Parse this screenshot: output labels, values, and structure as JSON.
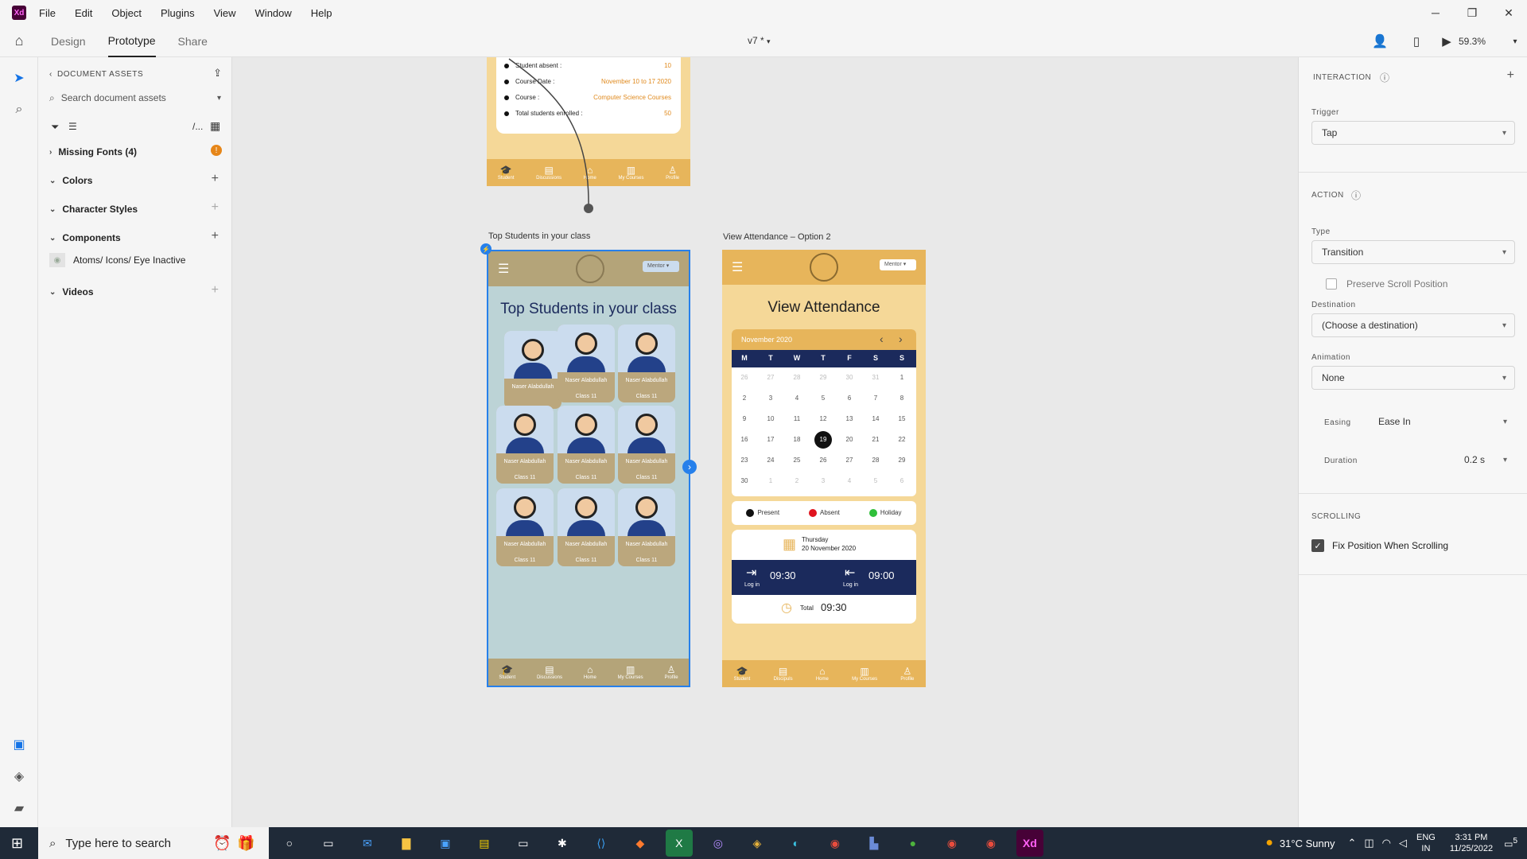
{
  "app": {
    "logo": "Xd",
    "menu": [
      "File",
      "Edit",
      "Object",
      "Plugins",
      "View",
      "Window",
      "Help"
    ],
    "modes": [
      "Design",
      "Prototype",
      "Share"
    ],
    "active_mode": "Prototype",
    "doc_title": "v7 *",
    "zoom": "59.3%"
  },
  "assets": {
    "header": "DOCUMENT ASSETS",
    "search_placeholder": "Search document assets",
    "view_toggle": "/...",
    "sections": {
      "missing_fonts": "Missing Fonts (4)",
      "colors": "Colors",
      "character_styles": "Character Styles",
      "components": "Components",
      "component_item": "Atoms/ Icons/ Eye Inactive",
      "videos": "Videos"
    }
  },
  "interaction": {
    "header": "INTERACTION",
    "trigger_label": "Trigger",
    "trigger_value": "Tap",
    "action_header": "ACTION",
    "type_label": "Type",
    "type_value": "Transition",
    "preserve_scroll": "Preserve Scroll Position",
    "destination_label": "Destination",
    "destination_value": "(Choose a destination)",
    "animation_label": "Animation",
    "animation_value": "None",
    "easing_label": "Easing",
    "easing_value": "Ease In",
    "duration_label": "Duration",
    "duration_value": "0.2 s",
    "scrolling_header": "SCROLLING",
    "fix_position": "Fix Position When Scrolling"
  },
  "top_artboard": {
    "rows": [
      {
        "label": "Student absent :",
        "value": "10"
      },
      {
        "label": "Course Date :",
        "value": "November 10 to 17 2020"
      },
      {
        "label": "Course :",
        "value": "Computer Science Courses"
      },
      {
        "label": "Total students enrolled :",
        "value": "50"
      }
    ],
    "nav": [
      "Student",
      "Discussions",
      "Home",
      "My Courses",
      "Profile"
    ]
  },
  "students_artboard": {
    "label": "Top Students in your class",
    "mentor": "Mentor",
    "heading": "Top Students in your class",
    "cards": [
      {
        "name": "Naser Alabdullah",
        "class": ""
      },
      {
        "name": "Naser Alabdullah",
        "class": "Class 11"
      },
      {
        "name": "Naser Alabdullah",
        "class": "Class 11"
      },
      {
        "name": "Naser Alabdullah",
        "class": "Class 11"
      },
      {
        "name": "Naser Alabdullah",
        "class": "Class 11"
      },
      {
        "name": "Naser Alabdullah",
        "class": "Class 11"
      },
      {
        "name": "Naser Alabdullah",
        "class": "Class 11"
      },
      {
        "name": "Naser Alabdullah",
        "class": "Class 11"
      },
      {
        "name": "Naser Alabdullah",
        "class": "Class 11"
      }
    ],
    "nav": [
      "Student",
      "Discussions",
      "Home",
      "My Courses",
      "Profile"
    ]
  },
  "attendance_artboard": {
    "label": "View Attendance – Option 2",
    "mentor": "Mentor",
    "heading": "View Attendance",
    "month": "November 2020",
    "weekdays": [
      "M",
      "T",
      "W",
      "T",
      "F",
      "S",
      "S"
    ],
    "days": [
      [
        "26",
        "27",
        "28",
        "29",
        "30",
        "31",
        "1"
      ],
      [
        "2",
        "3",
        "4",
        "5",
        "6",
        "7",
        "8"
      ],
      [
        "9",
        "10",
        "11",
        "12",
        "13",
        "14",
        "15"
      ],
      [
        "16",
        "17",
        "18",
        "19",
        "20",
        "21",
        "22"
      ],
      [
        "23",
        "24",
        "25",
        "26",
        "27",
        "28",
        "29"
      ],
      [
        "30",
        "1",
        "2",
        "3",
        "4",
        "5",
        "6"
      ]
    ],
    "selected_day": "19",
    "legend": [
      "Present",
      "Absent",
      "Holiday"
    ],
    "legend_colors": [
      "#111111",
      "#e0141e",
      "#2fbf3a"
    ],
    "day_name": "Thursday",
    "date": "20 November 2020",
    "login_time": "09:30",
    "logout_time": "09:00",
    "login_label": "Log in",
    "logout_label": "Log in",
    "total_label": "Total",
    "total_time": "09:30",
    "nav": [
      "Student",
      "Discipuls",
      "Home",
      "My Courses",
      "Profile"
    ]
  },
  "taskbar": {
    "search_placeholder": "Type here to search",
    "weather": "31°C  Sunny",
    "lang": "ENG",
    "region": "IN",
    "time": "3:31 PM",
    "date": "11/25/2022",
    "notifications": "5"
  },
  "colors": {
    "accent": "#e7b55b",
    "navy": "#1b2a5c",
    "xd": "#470137"
  }
}
